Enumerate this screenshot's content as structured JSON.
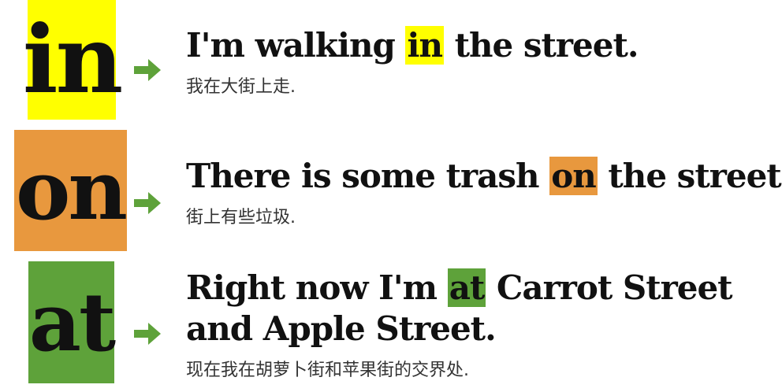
{
  "colors": {
    "in": "#ffff00",
    "on": "#e8983e",
    "at": "#5ea23a",
    "arrow": "#5ea23a",
    "text": "#111111"
  },
  "rows": [
    {
      "word": "in",
      "sentence": {
        "before": "I'm walking ",
        "highlight": "in",
        "after": " the street."
      },
      "translation": "我在大街上走."
    },
    {
      "word": "on",
      "sentence": {
        "before": "There is some trash ",
        "highlight": "on",
        "after": " the street."
      },
      "translation": "街上有些垃圾."
    },
    {
      "word": "at",
      "sentence": {
        "before": "Right now I'm ",
        "highlight": "at",
        "after": " Carrot Street",
        "line2": "and Apple Street."
      },
      "translation": "现在我在胡萝卜街和苹果街的交界处."
    }
  ],
  "icons": {
    "arrow": "arrow-right-icon"
  }
}
